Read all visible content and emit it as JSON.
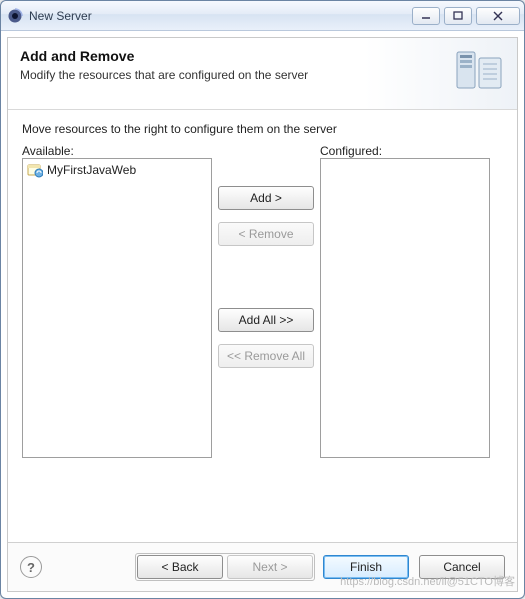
{
  "window": {
    "title": "New Server"
  },
  "banner": {
    "heading": "Add and Remove",
    "subheading": "Modify the resources that are configured on the server"
  },
  "content": {
    "instruction": "Move resources to the right to configure them on the server",
    "available_label": "Available:",
    "configured_label": "Configured:",
    "available_items": [
      {
        "label": "MyFirstJavaWeb"
      }
    ],
    "configured_items": []
  },
  "buttons": {
    "add": "Add >",
    "remove": "< Remove",
    "add_all": "Add All >>",
    "remove_all": "<< Remove All"
  },
  "footer": {
    "back": "< Back",
    "next": "Next >",
    "finish": "Finish",
    "cancel": "Cancel"
  },
  "watermark": "https://blog.csdn.net/li@51CTO博客"
}
